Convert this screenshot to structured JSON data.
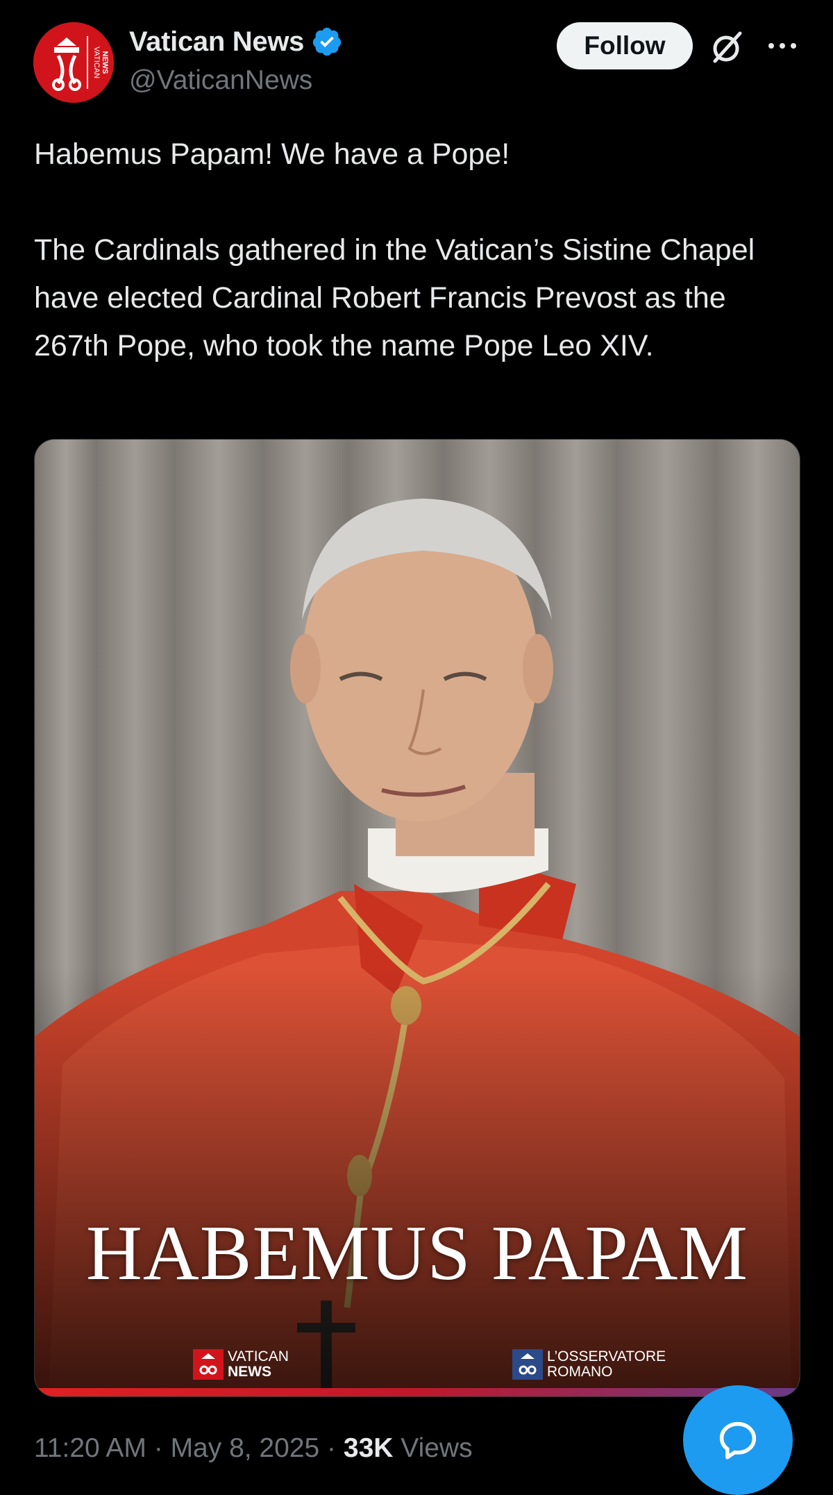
{
  "header": {
    "display_name": "Vatican News",
    "handle": "@VaticanNews",
    "follow_label": "Follow",
    "avatar_text": "VATICAN NEWS",
    "verified": true
  },
  "tweet": {
    "line1": "Habemus Papam! We have a Pope!",
    "line2": "The Cardinals gathered in the Vatican’s Sistine Chapel have elected Cardinal Robert Francis Prevost as the 267th Pope, who took the name Pope Leo XIV."
  },
  "media": {
    "title": "HABEMUS PAPAM",
    "logo_left_line1": "VATICAN",
    "logo_left_line2": "NEWS",
    "logo_right_line1": "L’OSSERVATORE",
    "logo_right_line2": "ROMANO"
  },
  "meta": {
    "time": "11:20 AM",
    "sep1": " · ",
    "date": "May 8, 2025",
    "sep2": " · ",
    "views_count": "33K",
    "views_label": " Views"
  },
  "colors": {
    "background": "#000000",
    "text": "#e7e9ea",
    "secondary": "#71767b",
    "accent_blue": "#1d9bf0",
    "brand_red": "#d1141b"
  },
  "icons": [
    "verified-badge-icon",
    "grok-icon",
    "more-options-icon",
    "reply-compose-icon"
  ]
}
